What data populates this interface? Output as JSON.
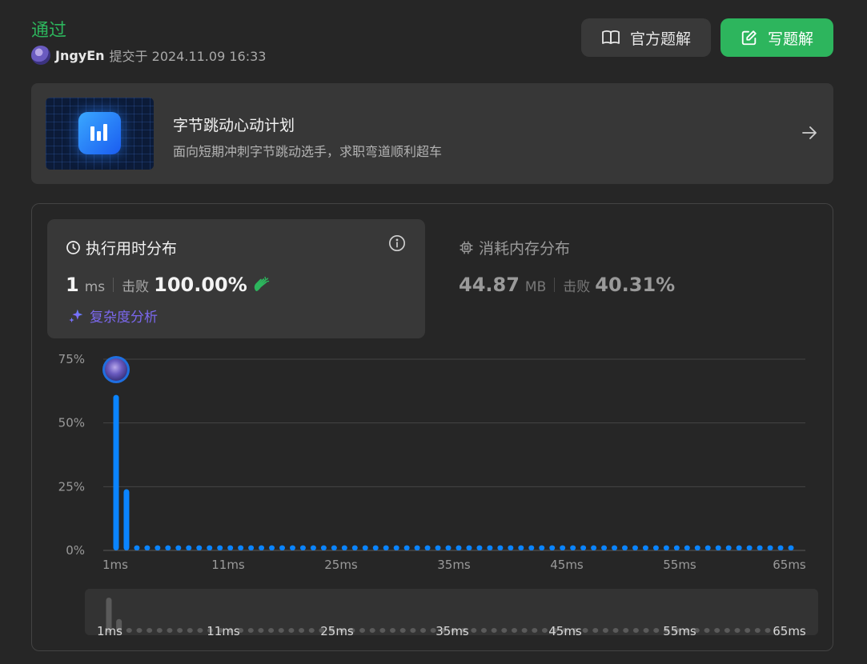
{
  "status": "通过",
  "submission": {
    "user": "JngyEn",
    "submitted_text": "提交于 2024.11.09 16:33"
  },
  "buttons": {
    "official": "官方题解",
    "write": "写题解"
  },
  "banner": {
    "title": "字节跳动心动计划",
    "subtitle": "面向短期冲刺字节跳动选手，求职弯道顺利超车"
  },
  "runtime": {
    "title": "执行用时分布",
    "value": "1",
    "unit": "ms",
    "beats_label": "击败",
    "beats": "100.00%",
    "complexity_link": "复杂度分析"
  },
  "memory": {
    "title": "消耗内存分布",
    "value": "44.87",
    "unit": "MB",
    "beats_label": "击败",
    "beats": "40.31%"
  },
  "colors": {
    "accepted": "#2db55d",
    "bar": "#0a84ff",
    "mini_bar": "#5a5a5a",
    "link": "#7b68ee"
  },
  "icons": [
    "clock-icon",
    "info-icon",
    "clap-icon",
    "sparkle-icon",
    "chip-icon",
    "book-icon",
    "edit-icon",
    "arrow-right-icon"
  ],
  "chart_data": {
    "type": "bar",
    "x_ticks": [
      "1ms",
      "11ms",
      "25ms",
      "35ms",
      "45ms",
      "55ms",
      "65ms"
    ],
    "y_ticks": [
      "0%",
      "25%",
      "50%",
      "75%"
    ],
    "ylim": [
      0,
      75
    ],
    "x": [
      1,
      2,
      3,
      4,
      5,
      6,
      7,
      8,
      9,
      10,
      11,
      12,
      13,
      14,
      15,
      16,
      17,
      18,
      19,
      20,
      21,
      22,
      23,
      24,
      25,
      26,
      27,
      28,
      29,
      30,
      31,
      32,
      33,
      34,
      35,
      36,
      37,
      38,
      39,
      40,
      41,
      42,
      43,
      44,
      45,
      46,
      47,
      48,
      49,
      50,
      51,
      52,
      53,
      54,
      55,
      56,
      57,
      58,
      59,
      60,
      61,
      62,
      63,
      64,
      65,
      66
    ],
    "values": [
      61,
      24,
      2,
      2,
      2,
      2,
      2,
      2,
      2,
      2,
      2,
      2,
      2,
      2,
      2,
      2,
      2,
      2,
      2,
      2,
      2,
      2,
      2,
      2,
      2,
      2,
      2,
      2,
      2,
      2,
      2,
      2,
      2,
      2,
      2,
      2,
      2,
      2,
      2,
      2,
      2,
      2,
      2,
      2,
      2,
      2,
      2,
      2,
      2,
      2,
      2,
      2,
      2,
      2,
      2,
      2,
      2,
      2,
      2,
      2,
      2,
      2,
      2,
      2,
      2,
      2
    ],
    "marker_x": 1,
    "mini_x_ticks": [
      "1ms",
      "11ms",
      "25ms",
      "35ms",
      "45ms",
      "55ms",
      "65ms"
    ],
    "grid": true,
    "legend": "none"
  }
}
